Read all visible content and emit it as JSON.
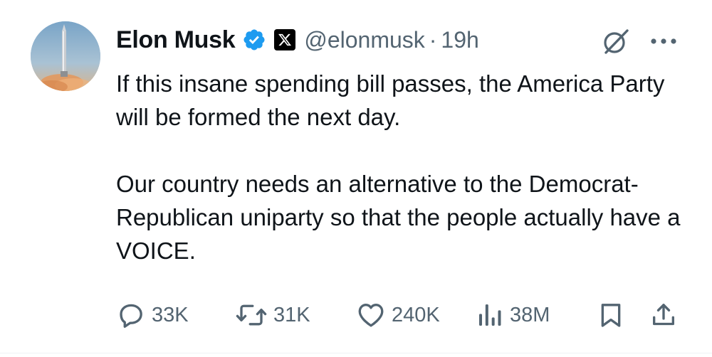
{
  "author": {
    "name": "Elon Musk",
    "handle": "@elonmusk",
    "separator": "·",
    "time": "19h"
  },
  "tweet": {
    "paragraph_1": "If this insane spending bill passes, the America Party will be formed the next day.",
    "paragraph_2": "Our country needs an alternative to the Democrat-Republican uniparty so that the people actually have a VOICE."
  },
  "metrics": {
    "replies": "33K",
    "reposts": "31K",
    "likes": "240K",
    "views": "38M"
  },
  "colors": {
    "text": "#0f1419",
    "secondary": "#536471",
    "verified": "#1d9bf0"
  },
  "icons": [
    "verified-badge-icon",
    "x-affiliate-icon",
    "grok-icon",
    "more-icon",
    "reply-icon",
    "repost-icon",
    "like-icon",
    "views-icon",
    "bookmark-icon",
    "share-icon"
  ]
}
